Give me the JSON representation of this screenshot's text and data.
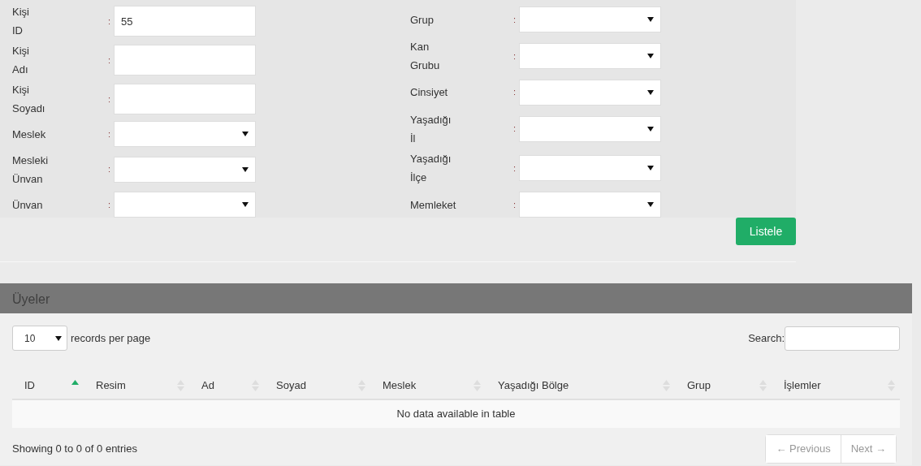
{
  "filter_form": {
    "left_fields": [
      {
        "label": "Kişi ID",
        "separator": ":",
        "kind": "text",
        "value": "55"
      },
      {
        "label": "Kişi Adı",
        "separator": ":",
        "kind": "text"
      },
      {
        "label": "Kişi Soyadı",
        "separator": ":",
        "kind": "text"
      },
      {
        "label": "Meslek",
        "separator": ":",
        "kind": "select"
      },
      {
        "label": "Mesleki Ünvan",
        "separator": ":",
        "kind": "select"
      },
      {
        "label": "Ünvan",
        "separator": ":",
        "kind": "select"
      }
    ],
    "right_fields": [
      {
        "label": "Grup",
        "separator": ":",
        "kind": "select"
      },
      {
        "label": "Kan Grubu",
        "separator": ":",
        "kind": "select"
      },
      {
        "label": "Cinsiyet",
        "separator": ":",
        "kind": "select"
      },
      {
        "label": "Yaşadığı İl",
        "separator": ":",
        "kind": "select"
      },
      {
        "label": "Yaşadığı İlçe",
        "separator": ":",
        "kind": "select"
      },
      {
        "label": "Memleket",
        "separator": ":",
        "kind": "select"
      }
    ],
    "submit_button": "Listele"
  },
  "members_panel": {
    "title": "Üyeler",
    "page_length": {
      "value": "10",
      "label": "records per page"
    },
    "search": {
      "label": "Search:"
    },
    "table": {
      "columns": [
        {
          "label": "ID",
          "sorted": true
        },
        {
          "label": "Resim",
          "sorted": false
        },
        {
          "label": "Ad",
          "sorted": false
        },
        {
          "label": "Soyad",
          "sorted": false
        },
        {
          "label": "Meslek",
          "sorted": false
        },
        {
          "label": "Yaşadığı Bölge",
          "sorted": false
        },
        {
          "label": "Grup",
          "sorted": false
        },
        {
          "label": "İşlemler",
          "sorted": false
        }
      ],
      "empty_message": "No data available in table"
    },
    "info": "Showing 0 to 0 of 0 entries",
    "pagination": [
      {
        "label": "← Previous",
        "disabled": true
      },
      {
        "label": "Next →",
        "disabled": true
      }
    ]
  }
}
